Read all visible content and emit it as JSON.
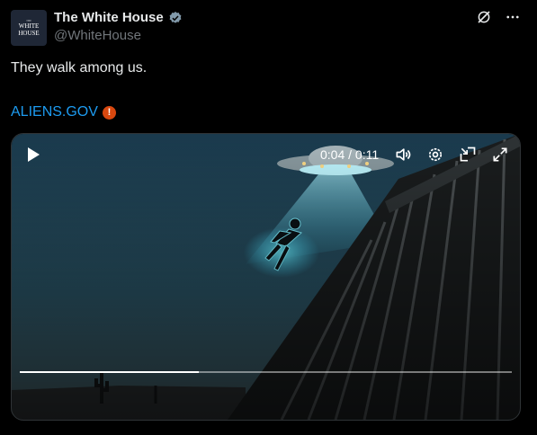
{
  "account": {
    "display_name": "The White House",
    "handle": "@WhiteHouse",
    "avatar_text_line1": "WHITE",
    "avatar_text_line2": "HOUSE",
    "avatar_text_top": "THE"
  },
  "tweet": {
    "text": "They walk among us.",
    "link_text": "ALIENS.GOV"
  },
  "video": {
    "time_display": "0:04 / 0:11",
    "progress_fraction": 0.364
  },
  "icons": {
    "verified": "verified-badge-icon",
    "grok": "grok-icon",
    "more": "more-dots-icon",
    "warning": "warning-icon",
    "play": "play-icon",
    "volume": "volume-icon",
    "settings": "settings-icon",
    "pip": "picture-in-picture-icon",
    "fullscreen": "fullscreen-icon"
  },
  "colors": {
    "link": "#1d9bf0",
    "verified": "#829aab",
    "warning": "#d9480f",
    "beam": "#3fd8ff"
  }
}
